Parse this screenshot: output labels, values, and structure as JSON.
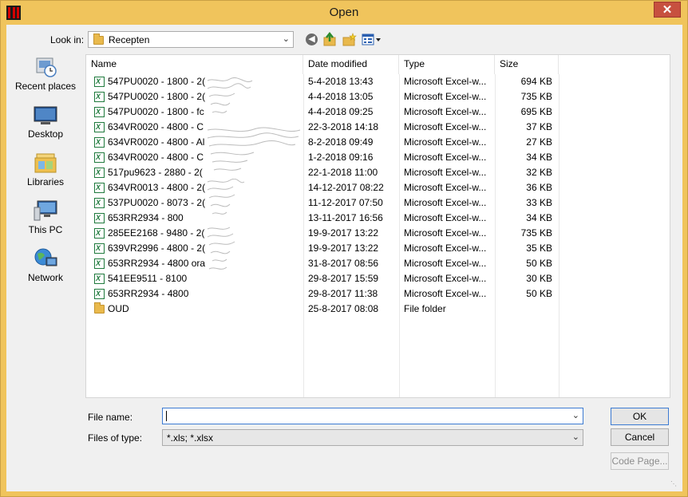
{
  "window": {
    "title": "Open"
  },
  "toolbar": {
    "look_in_label": "Look in:",
    "look_in_value": "Recepten"
  },
  "places": [
    {
      "label": "Recent places",
      "icon": "recent-places-icon"
    },
    {
      "label": "Desktop",
      "icon": "desktop-icon"
    },
    {
      "label": "Libraries",
      "icon": "libraries-icon"
    },
    {
      "label": "This PC",
      "icon": "this-pc-icon"
    },
    {
      "label": "Network",
      "icon": "network-icon"
    }
  ],
  "columns": {
    "name": "Name",
    "date": "Date modified",
    "type": "Type",
    "size": "Size"
  },
  "files": [
    {
      "name": "547PU0020 - 1800 - 2(",
      "date": "5-4-2018 13:43",
      "type": "Microsoft Excel-w...",
      "size": "694 KB",
      "icon": "excel-file-icon"
    },
    {
      "name": "547PU0020 - 1800 - 2(",
      "date": "4-4-2018 13:05",
      "type": "Microsoft Excel-w...",
      "size": "735 KB",
      "icon": "excel-file-icon"
    },
    {
      "name": "547PU0020 - 1800 - fc",
      "date": "4-4-2018 09:25",
      "type": "Microsoft Excel-w...",
      "size": "695 KB",
      "icon": "excel-file-icon"
    },
    {
      "name": "634VR0020 - 4800 - C",
      "date": "22-3-2018 14:18",
      "type": "Microsoft Excel-w...",
      "size": "37 KB",
      "icon": "excel-file-icon"
    },
    {
      "name": "634VR0020 - 4800 - Al",
      "date": "8-2-2018 09:49",
      "type": "Microsoft Excel-w...",
      "size": "27 KB",
      "icon": "excel-file-icon"
    },
    {
      "name": "634VR0020 - 4800 - C",
      "date": "1-2-2018 09:16",
      "type": "Microsoft Excel-w...",
      "size": "34 KB",
      "icon": "excel-file-icon"
    },
    {
      "name": "517pu9623 - 2880 - 2(",
      "date": "22-1-2018 11:00",
      "type": "Microsoft Excel-w...",
      "size": "32 KB",
      "icon": "excel-file-icon"
    },
    {
      "name": "634VR0013 - 4800 - 2(",
      "date": "14-12-2017 08:22",
      "type": "Microsoft Excel-w...",
      "size": "36 KB",
      "icon": "excel-file-icon"
    },
    {
      "name": "537PU0020 - 8073 - 2(",
      "date": "11-12-2017 07:50",
      "type": "Microsoft Excel-w...",
      "size": "33 KB",
      "icon": "excel-file-icon"
    },
    {
      "name": "653RR2934 - 800",
      "date": "13-11-2017 16:56",
      "type": "Microsoft Excel-w...",
      "size": "34 KB",
      "icon": "excel-file-icon"
    },
    {
      "name": "285EE2168 - 9480 - 2(",
      "date": "19-9-2017 13:22",
      "type": "Microsoft Excel-w...",
      "size": "735 KB",
      "icon": "excel-file-icon"
    },
    {
      "name": "639VR2996 - 4800 - 2(",
      "date": "19-9-2017 13:22",
      "type": "Microsoft Excel-w...",
      "size": "35 KB",
      "icon": "excel-file-icon"
    },
    {
      "name": "653RR2934 - 4800 ora",
      "date": "31-8-2017 08:56",
      "type": "Microsoft Excel-w...",
      "size": "50 KB",
      "icon": "excel-file-icon"
    },
    {
      "name": "541EE9511 - 8100",
      "date": "29-8-2017 15:59",
      "type": "Microsoft Excel-w...",
      "size": "30 KB",
      "icon": "excel-file-icon"
    },
    {
      "name": "653RR2934 - 4800",
      "date": "29-8-2017 11:38",
      "type": "Microsoft Excel-w...",
      "size": "50 KB",
      "icon": "excel-file-icon"
    },
    {
      "name": "OUD",
      "date": "25-8-2017 08:08",
      "type": "File folder",
      "size": "",
      "icon": "folder-icon"
    }
  ],
  "bottom": {
    "file_name_label": "File name:",
    "file_name_value": "",
    "files_of_type_label": "Files of type:",
    "files_of_type_value": "*.xls; *.xlsx",
    "ok_label": "OK",
    "cancel_label": "Cancel",
    "code_page_label": "Code Page..."
  },
  "colors": {
    "frame": "#f0c45c",
    "close_button": "#c7503f",
    "focus_border": "#3d7bd2"
  }
}
